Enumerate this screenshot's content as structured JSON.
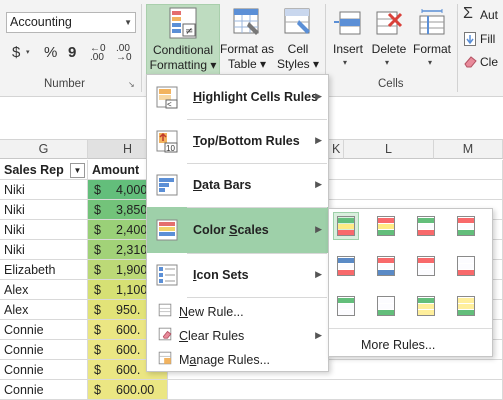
{
  "ribbon": {
    "number_format": {
      "value": "Accounting"
    },
    "number_group_label": "Number",
    "cells_group_label": "Cells",
    "conditional_formatting": {
      "line1": "Conditional",
      "line2": "Formatting ▾"
    },
    "format_as_table": {
      "line1": "Format as",
      "line2": "Table ▾"
    },
    "cell_styles": {
      "line1": "Cell",
      "line2": "Styles ▾"
    },
    "insert": {
      "label": "Insert"
    },
    "delete": {
      "label": "Delete"
    },
    "format": {
      "label": "Format"
    },
    "editing": {
      "autosum": "Aut",
      "fill": "Fill",
      "clear": "Cle"
    },
    "number_symbols": {
      "currency": "$",
      "percent": "%",
      "comma": "9"
    }
  },
  "columns": [
    {
      "label": "G",
      "selected": false
    },
    {
      "label": "H",
      "selected": true
    },
    {
      "label": "K",
      "selected": false
    },
    {
      "label": "L",
      "selected": false
    },
    {
      "label": "M",
      "selected": false
    }
  ],
  "table": {
    "headers": [
      "Sales Rep",
      "Amount"
    ],
    "rows": [
      {
        "rep": "Niki",
        "currency": "$",
        "amount": "4,000.",
        "color": "#63be7b"
      },
      {
        "rep": "Niki",
        "currency": "$",
        "amount": "3,850.",
        "color": "#73c37a"
      },
      {
        "rep": "Niki",
        "currency": "$",
        "amount": "2,400.",
        "color": "#9ad078"
      },
      {
        "rep": "Niki",
        "currency": "$",
        "amount": "2,310.",
        "color": "#a2d278"
      },
      {
        "rep": "Elizabeth",
        "currency": "$",
        "amount": "1,900.",
        "color": "#bcd977"
      },
      {
        "rep": "Alex",
        "currency": "$",
        "amount": "1,100.",
        "color": "#d6e074"
      },
      {
        "rep": "Alex",
        "currency": "$",
        "amount": "950.",
        "color": "#e2e378"
      },
      {
        "rep": "Connie",
        "currency": "$",
        "amount": "600.",
        "color": "#ebe683"
      },
      {
        "rep": "Connie",
        "currency": "$",
        "amount": "600.",
        "color": "#ebe683"
      },
      {
        "rep": "Connie",
        "currency": "$",
        "amount": "600.",
        "color": "#ebe683"
      },
      {
        "rep": "Connie",
        "currency": "$",
        "amount": "600.00",
        "color": "#ebe683"
      }
    ]
  },
  "cf_menu": {
    "items": [
      {
        "label": "Highlight Cells Rules",
        "underline_index": 0,
        "bold": true,
        "submenu": true,
        "icon": "highlight-cells-icon"
      },
      {
        "label": "Top/Bottom Rules",
        "underline_index": 0,
        "bold": true,
        "submenu": true,
        "icon": "top-bottom-icon"
      },
      {
        "label": "Data Bars",
        "underline_index": 0,
        "bold": true,
        "submenu": true,
        "icon": "data-bars-icon"
      },
      {
        "label": "Color Scales",
        "underline_index": 6,
        "bold": true,
        "submenu": true,
        "highlighted": true,
        "icon": "color-scales-icon"
      },
      {
        "label": "Icon Sets",
        "underline_index": 0,
        "bold": true,
        "submenu": true,
        "icon": "icon-sets-icon"
      },
      {
        "label": "New Rule...",
        "underline_index": 0,
        "bold": false,
        "submenu": false,
        "icon": "new-rule-icon"
      },
      {
        "label": "Clear Rules",
        "underline_index": 0,
        "bold": false,
        "submenu": true,
        "icon": "clear-rules-icon"
      },
      {
        "label": "Manage Rules...",
        "underline_index": 1,
        "bold": false,
        "submenu": false,
        "icon": "manage-rules-icon"
      }
    ]
  },
  "color_scales": {
    "more_rules": "More Rules...",
    "swatches": [
      [
        "#63be7b",
        "#ffeb84",
        "#f8696b"
      ],
      [
        "#f8696b",
        "#ffeb84",
        "#63be7b"
      ],
      [
        "#63be7b",
        "#fcfcff",
        "#f8696b"
      ],
      [
        "#f8696b",
        "#fcfcff",
        "#63be7b"
      ],
      [
        "#5a8ac6",
        "#fcfcff",
        "#f8696b"
      ],
      [
        "#f8696b",
        "#fcfcff",
        "#5a8ac6"
      ],
      [
        "#f8696b",
        "#fcfcff",
        "#fcfcff"
      ],
      [
        "#fcfcff",
        "#fcfcff",
        "#f8696b"
      ],
      [
        "#63be7b",
        "#fcfcff",
        "#fcfcff"
      ],
      [
        "#fcfcff",
        "#fcfcff",
        "#63be7b"
      ],
      [
        "#63be7b",
        "#ffef9c",
        "#ffef9c"
      ],
      [
        "#ffef9c",
        "#ffef9c",
        "#63be7b"
      ]
    ]
  }
}
